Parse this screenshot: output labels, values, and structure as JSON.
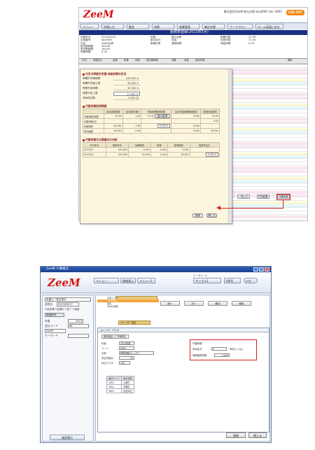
{
  "top": {
    "logo": "ZeeM",
    "logout_label": "LOG OUT",
    "user_line": "株式会社ZeeM  給与太郎  kou0001  Ver. 0001",
    "menu": [
      "メニュー",
      "申請入力",
      "勤怠",
      "休暇",
      "就業管理",
      "集計処理",
      "ワークフロー",
      "ホーム画面に戻る"
    ],
    "page_title": "勤務表登録(2013年5月)",
    "info_cols": [
      [
        "対象年月",
        "社員番号",
        "氏名",
        "総労働時間",
        "実労働時間",
        "残業時間"
      ],
      [
        "2013/05/31",
        "kou0001",
        "ZeeM太郎",
        "160.00",
        "160.00",
        "0.00"
      ],
      [
        "所属",
        "給与区分",
        "勤務形態"
      ],
      [
        "給与太郎",
        "月給",
        "通常勤務"
      ],
      [
        "勤務日数",
        "出勤日数",
        "有給休暇"
      ],
      [
        "21.00",
        "21.00",
        "0.00"
      ]
    ],
    "grid_headers": [
      "日付",
      "勤務区分",
      "始業",
      "終業",
      "休憩",
      "実労働時間",
      "残業",
      "深夜",
      "遅刻早退",
      "備考"
    ],
    "modal": {
      "section1": "今月の時間外労働 有給休暇の状況",
      "rows1": [
        {
          "label": "時間外労働時間",
          "value": "100.000 h"
        },
        {
          "label": "時間外労働上限",
          "value": "40.000 h"
        },
        {
          "label": "残業予定時間",
          "value": "10.000 h"
        },
        {
          "label": "残業予定上限",
          "value": "11.000 h"
        },
        {
          "label": "有休残日数",
          "value": "1.000 日"
        }
      ],
      "section2": "代替休暇取得情報",
      "table2_headers": [
        "",
        "前月超過時間",
        "当月取得日数",
        "代替休暇取得時間",
        "当月代替休暇取得時間",
        "取得可能時間"
      ],
      "table2_rows": [
        [
          "代替休暇(時間)",
          "20.00",
          "1.00",
          "0.0 日",
          "0.00h",
          "10.00"
        ],
        [
          "代替休暇(日)",
          "",
          "",
          "",
          "",
          "0.00"
        ],
        [
          "休憩時間",
          "40.00h",
          "1.00",
          "0.000 h",
          "0.00h",
          ""
        ],
        [
          "前月繰越",
          "16.00h",
          "0.00",
          "",
          "0.00h",
          "16.00h"
        ]
      ],
      "section3": "代替休暇付与実績月の内訳",
      "table3_headers": [
        "付与年月",
        "取得年月",
        "休暇時間",
        "取得",
        "取得時間",
        "取得予定日"
      ],
      "table3_rows": [
        [
          "2013/03",
          "2013/05",
          "0.00h",
          "0.00h",
          "0.00h",
          ""
        ],
        [
          "2013/04",
          "2013/05",
          "16.00h",
          "0.00h",
          "16.00h",
          "0.000 h"
        ]
      ],
      "ok_label": "登録",
      "close_label": "閉じる"
    },
    "side_buttons": [
      "一覧入力",
      "打刻結果",
      "代替休暇"
    ]
  },
  "bottom": {
    "window_title": "ZeeM 人事給与",
    "logo": "ZeeM",
    "head_buttons": [
      "メニュー",
      "情報表示",
      "メニュー2"
    ],
    "head_labels": [
      "データベース",
      "サンプル1",
      "0001",
      "ログ"
    ],
    "company_label": "サンプル1",
    "code_label": "0001",
    "log_label": "ログ",
    "left": {
      "dropdown": "年度で一覧を表示",
      "date_label": "適用日",
      "date_value": "2013/05/17",
      "checks": [
        "未処理",
        "処理中",
        "完了",
        "承認"
      ],
      "search_label": "検索条件",
      "year_label": "年度",
      "year_value": "2013",
      "company_label": "会社コード",
      "company_value": "66",
      "name_value": "ZeeM",
      "keyword_label": "キーワード",
      "search_button": "検索実行"
    },
    "top_grid_rows": [
      "社員コード",
      "1000001",
      "姓名",
      "ZeeM太郎"
    ],
    "nav_buttons": [
      "前へ",
      "次へ",
      "最初",
      "最後"
    ],
    "dialog_tab": "カレンダー設定",
    "dialog_title": "カレンダーマスタ",
    "dialog_tabs": [
      "基本設定",
      "詳細設定"
    ],
    "fields": [
      {
        "label": "年度",
        "value": "2013年度"
      },
      {
        "label": "コード",
        "value": "0001"
      },
      {
        "label": "名称",
        "value": "標準勤務カレンダー"
      },
      {
        "label": "所定労働日",
        "value": "31"
      },
      {
        "label": "休日マスタ",
        "value": "100"
      }
    ],
    "sub_headers": [
      "休日コード",
      "休日名称"
    ],
    "sub_rows": [
      [
        "1001",
        "土曜日"
      ],
      [
        "2001",
        "日曜日"
      ],
      [
        "3001",
        "法定休日"
      ]
    ],
    "redbox_title": "代替休暇",
    "redbox_rows": [
      {
        "label": "有効区分",
        "value": "0",
        "note": "有効にしない"
      },
      {
        "label": "時間換算係数",
        "value": "0.500"
      }
    ],
    "foot_buttons": [
      "登録",
      "閉じる"
    ]
  }
}
